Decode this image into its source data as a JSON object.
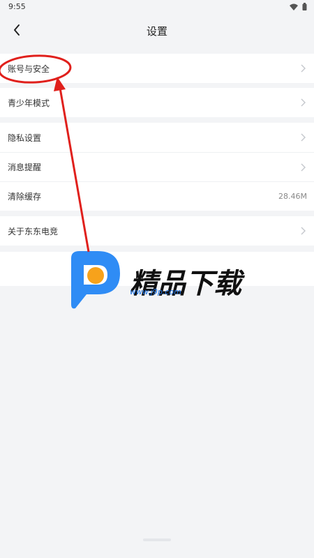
{
  "status_bar": {
    "time": "9:55",
    "icons": [
      "wifi-icon",
      "battery-icon"
    ]
  },
  "header": {
    "title": "设置",
    "back_icon": "back-arrow-icon"
  },
  "groups": [
    {
      "items": [
        {
          "label": "账号与安全"
        }
      ]
    },
    {
      "items": [
        {
          "label": "青少年模式"
        }
      ]
    },
    {
      "items": [
        {
          "label": "隐私设置"
        },
        {
          "label": "消息提醒"
        },
        {
          "label": "清除缓存",
          "value": "28.46M"
        }
      ]
    },
    {
      "items": [
        {
          "label": "关于东东电竞"
        }
      ]
    }
  ],
  "watermark": {
    "brand": "精品下载",
    "url": "www.j9p.com"
  },
  "colors": {
    "background": "#f3f4f6",
    "annotation": "#e0201c",
    "logo_blue": "#2f8cf5",
    "logo_orange": "#f7a21b",
    "url_blue": "#1a73e8"
  }
}
